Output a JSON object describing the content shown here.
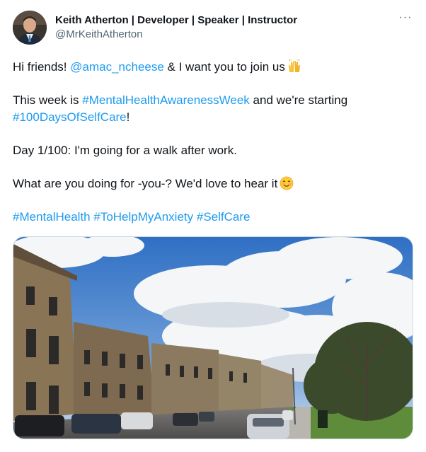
{
  "author": {
    "display_name": "Keith Atherton | Developer | Speaker | Instructor",
    "handle": "@MrKeithAtherton",
    "avatar_icon": "profile-photo"
  },
  "more_icon": "ellipsis-icon",
  "more_glyph": "···",
  "tweet": {
    "line1_prefix": "Hi friends! ",
    "line1_mention": "@amac_ncheese",
    "line1_suffix": " & I want you to join us",
    "line2_prefix": "This week is ",
    "line2_hashtag": "#MentalHealthAwarenessWeek",
    "line2_suffix": " and we're starting",
    "line3_hashtag": "#100DaysOfSelfCare",
    "line3_suffix": "!",
    "line4": "Day 1/100: I'm going for a walk after work.",
    "line5": "What are you doing for -you-? We'd love to hear it",
    "hashtags": [
      "#MentalHealth",
      "#ToHelpMyAnxiety",
      "#SelfCare"
    ]
  },
  "media": {
    "description_icon": "street-photo"
  },
  "colors": {
    "link": "#1d9bf0",
    "text": "#0f1419",
    "secondary": "#536471"
  }
}
